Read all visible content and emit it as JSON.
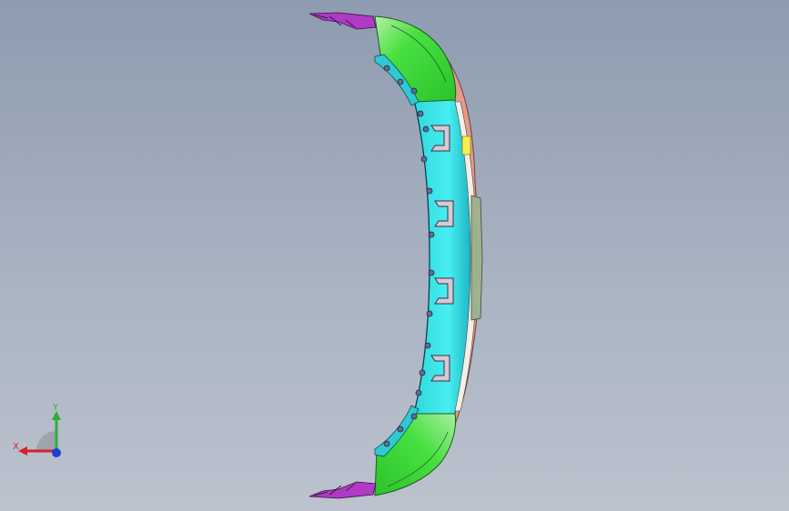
{
  "viewport": {
    "background_top": "#8e9cb0",
    "background_bottom": "#bcc2ce"
  },
  "model": {
    "description_colors": {
      "end_cap": "#3ddc3a",
      "end_cap_light": "#b6f0a8",
      "main_panel": "#37e6e6",
      "main_panel_dark": "#19b8c4",
      "outer_skin": "#e89a8a",
      "highlight": "#f5f04a",
      "bracket": "#b03ac6",
      "clip": "#5f6d92",
      "vent": "#d8c8d6"
    },
    "vent_count": 4
  },
  "triad": {
    "x_label": "X",
    "y_label": "Y",
    "x_color": "#d8202a",
    "y_color": "#2fae3b",
    "z_color": "#1f3fd6"
  }
}
